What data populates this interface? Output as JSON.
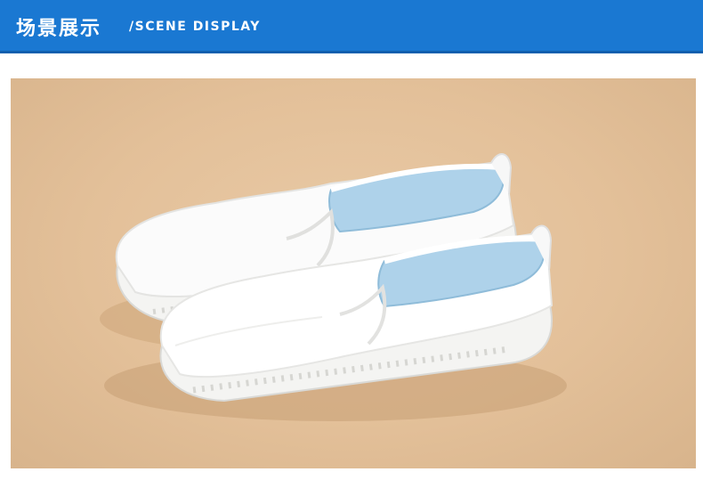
{
  "header": {
    "title_cn": "场景展示",
    "title_en": "/SCENE DISPLAY",
    "background": "#1a78d2"
  },
  "scene": {
    "background": "#e3c099",
    "shoe_color": "#ffffff",
    "lining_color": "#aed2ea"
  }
}
